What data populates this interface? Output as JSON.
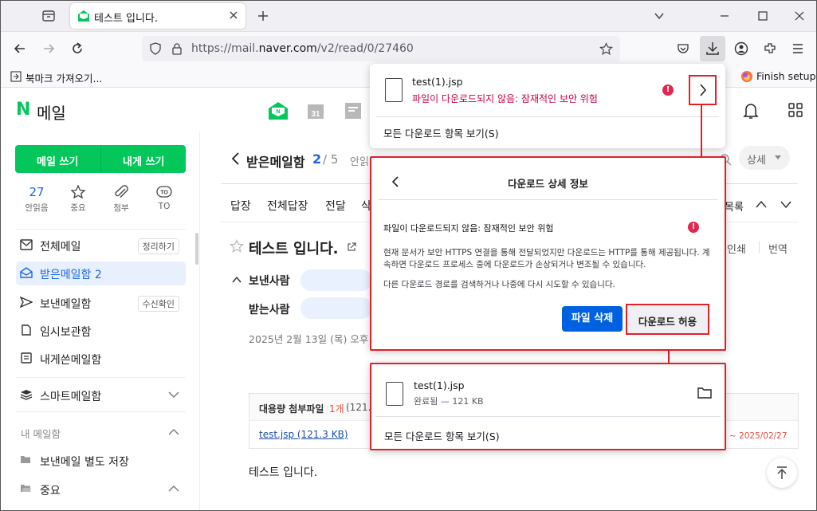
{
  "browser": {
    "tab_title": "테스트 입니다.",
    "url_prefix": "https://mail.",
    "url_domain": "naver.com",
    "url_path": "/v2/read/0/27460",
    "bookmark_import": "북마크 가져오기...",
    "finish_setup": "Finish setup"
  },
  "app": {
    "logo_n": "N",
    "logo_text": "메일"
  },
  "sidebar": {
    "write_mail": "메일 쓰기",
    "write_self": "내게 쓰기",
    "quick": [
      {
        "value": "27",
        "label": "안읽음"
      },
      {
        "label": "중요"
      },
      {
        "label": "첨부"
      },
      {
        "label": "TO"
      }
    ],
    "folders": [
      {
        "label": "전체메일",
        "tag": "정리하기"
      },
      {
        "label": "받은메일함",
        "count": "2"
      },
      {
        "label": "보낸메일함",
        "tag": "수신확인"
      },
      {
        "label": "임시보관함"
      },
      {
        "label": "내게쓴메일함"
      }
    ],
    "smart_mailbox": "스마트메일함",
    "my_mailbox": "내 메일함",
    "sub_folders": [
      {
        "label": "보낸메일 별도 저장"
      },
      {
        "label": "중요"
      }
    ]
  },
  "main": {
    "folder_title": "받은메일함",
    "position": "2",
    "total": "/ 5",
    "unread_hint": "안읽",
    "detail_label": "상세",
    "actions": [
      "답장",
      "전체답장",
      "전달",
      "삭"
    ],
    "list_label": "목록",
    "subject": "테스트 입니다.",
    "print_label": "인쇄",
    "translate_label": "번역",
    "from_label": "보낸사람",
    "to_label": "받는사람",
    "date": "2025년 2월 13일 (목) 오후",
    "attach_header": "대용량 첨부파일",
    "attach_count": "1개",
    "attach_size": "(121.3",
    "attach_link": "test.jsp (121.3 KB)",
    "attach_expire": "~ 2025/02/27",
    "body": "테스트 입니다."
  },
  "download_panel": {
    "file_name": "test(1).jsp",
    "file_status": "파일이 다운로드되지 않음: 잠재적인 보안 위험",
    "show_all": "모든 다운로드 항목 보기(S)"
  },
  "detail_panel": {
    "title": "다운로드 상세 정보",
    "warning": "파일이 다운로드되지 않음: 잠재적인 보안 위험",
    "desc1": "현재 문서가 보안 HTTPS 연결을 통해 전달되었지만 다운로드는 HTTP를 통해 제공됩니다. 계속하면 다운로드 프로세스 중에 다운로드가 손상되거나 변조될 수 있습니다.",
    "desc2": "다른 다운로드 경로를 검색하거나 나중에 다시 시도할 수 있습니다.",
    "delete_button": "파일 삭제",
    "allow_button": "다운로드 허용"
  },
  "completed_panel": {
    "file_name": "test(1).jsp",
    "file_status": "완료됨 — 121 KB",
    "show_all": "모든 다운로드 항목 보기(S)"
  },
  "colors": {
    "naver_green": "#03c75a",
    "annotation_red": "#e0202a",
    "firefox_blue": "#0061e0"
  }
}
